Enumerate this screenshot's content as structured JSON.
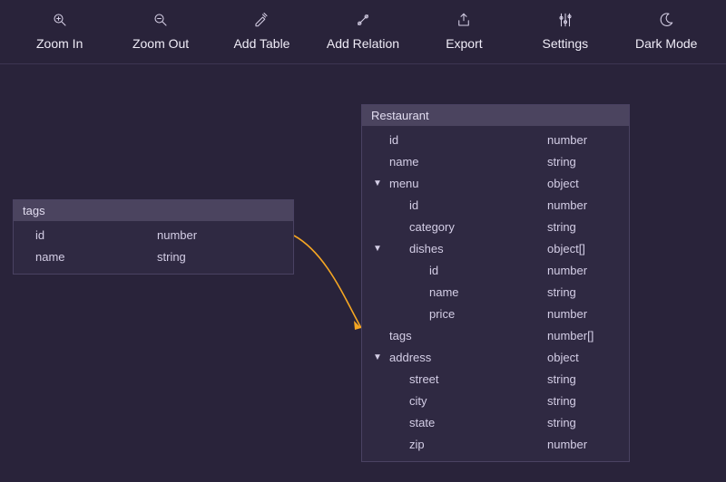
{
  "toolbar": {
    "zoom_in": {
      "label": "Zoom In"
    },
    "zoom_out": {
      "label": "Zoom Out"
    },
    "add_table": {
      "label": "Add Table"
    },
    "add_rel": {
      "label": "Add Relation"
    },
    "export": {
      "label": "Export"
    },
    "settings": {
      "label": "Settings"
    },
    "dark_mode": {
      "label": "Dark Mode"
    }
  },
  "tables": {
    "tags": {
      "title": "tags",
      "rows": [
        {
          "name": "id",
          "type": "number"
        },
        {
          "name": "name",
          "type": "string"
        }
      ]
    },
    "restaurant": {
      "title": "Restaurant",
      "rows": [
        {
          "indent": 0,
          "toggle": "",
          "name": "id",
          "type": "number"
        },
        {
          "indent": 0,
          "toggle": "",
          "name": "name",
          "type": "string"
        },
        {
          "indent": 0,
          "toggle": "▼",
          "name": "menu",
          "type": "object"
        },
        {
          "indent": 1,
          "toggle": "",
          "name": "id",
          "type": "number"
        },
        {
          "indent": 1,
          "toggle": "",
          "name": "category",
          "type": "string"
        },
        {
          "indent": 1,
          "toggle": "▼",
          "name": "dishes",
          "type": "object[]"
        },
        {
          "indent": 2,
          "toggle": "",
          "name": "id",
          "type": "number"
        },
        {
          "indent": 2,
          "toggle": "",
          "name": "name",
          "type": "string"
        },
        {
          "indent": 2,
          "toggle": "",
          "name": "price",
          "type": "number"
        },
        {
          "indent": 0,
          "toggle": "",
          "name": "tags",
          "type": "number[]"
        },
        {
          "indent": 0,
          "toggle": "▼",
          "name": "address",
          "type": "object"
        },
        {
          "indent": 1,
          "toggle": "",
          "name": "street",
          "type": "string"
        },
        {
          "indent": 1,
          "toggle": "",
          "name": "city",
          "type": "string"
        },
        {
          "indent": 1,
          "toggle": "",
          "name": "state",
          "type": "string"
        },
        {
          "indent": 1,
          "toggle": "",
          "name": "zip",
          "type": "number"
        }
      ]
    }
  },
  "relations": [
    {
      "from_table": "tags",
      "to_table": "restaurant",
      "to_field": "tags"
    }
  ],
  "colors": {
    "bg": "#29233a",
    "panel": "#2f2942",
    "panel_border": "#4a4262",
    "header": "#4b445f",
    "text": "#e6e2f0",
    "relation": "#f5a623"
  }
}
